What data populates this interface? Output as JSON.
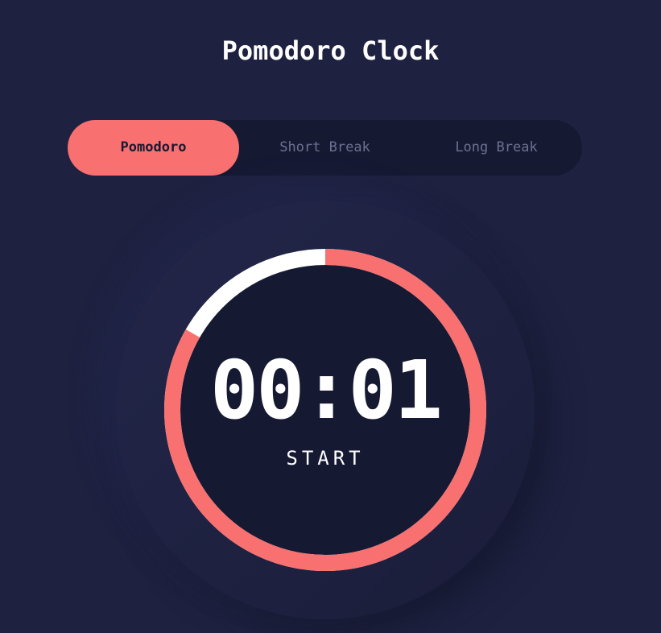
{
  "header": {
    "title": "Pomodoro Clock"
  },
  "modes": [
    {
      "label": "Pomodoro",
      "active": true
    },
    {
      "label": "Short Break",
      "active": false
    },
    {
      "label": "Long Break",
      "active": false
    }
  ],
  "timer": {
    "time": "00:01",
    "action_label": "START",
    "remaining_fraction": 0.833
  },
  "colors": {
    "accent": "#f87070",
    "background": "#1e2140",
    "dial": "#161932",
    "elapsed": "#ffffff"
  }
}
